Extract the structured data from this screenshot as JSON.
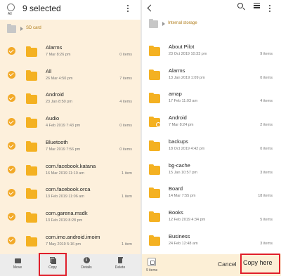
{
  "left": {
    "all_label": "All",
    "title": "9 selected",
    "breadcrumb": "SD card",
    "items": [
      {
        "name": "Alarms",
        "date": "7 Mar 8:26 pm",
        "count": "0 items"
      },
      {
        "name": "All",
        "date": "26 Mar 4:50 pm",
        "count": "7 items"
      },
      {
        "name": "Android",
        "date": "23 Jan 8:50 pm",
        "count": "4 items"
      },
      {
        "name": "Audio",
        "date": "4 Feb 2019 7:43 pm",
        "count": "0 items"
      },
      {
        "name": "Bluetooth",
        "date": "7 Mar 2019 7:56 pm",
        "count": "0 items"
      },
      {
        "name": "com.facebook.katana",
        "date": "16 Mar 2019 11:10 am",
        "count": "1 item"
      },
      {
        "name": "com.facebook.orca",
        "date": "13 Feb 2019 11:06 am",
        "count": "1 item"
      },
      {
        "name": "com.garena.msdk",
        "date": "13 Feb 2019 8:28 pm",
        "count": ""
      },
      {
        "name": "com.imo.android.imoim",
        "date": "7 May 2019 5:16 pm",
        "count": "1 item"
      }
    ],
    "bottom": {
      "move": "Move",
      "copy": "Copy",
      "details": "Details",
      "delete": "Delete"
    }
  },
  "right": {
    "breadcrumb": "Internal storage",
    "items": [
      {
        "name": "About Pilot",
        "date": "23 Oct 2019 10:33 pm",
        "count": "9 items"
      },
      {
        "name": "Alarms",
        "date": "13 Jan 2019 1:09 pm",
        "count": "0 items"
      },
      {
        "name": "amap",
        "date": "17 Feb 11:03 am",
        "count": "4 items"
      },
      {
        "name": "Android",
        "date": "7 Mar 8:24 pm",
        "count": "2 items"
      },
      {
        "name": "backups",
        "date": "18 Oct 2019 4:42 pm",
        "count": "0 items"
      },
      {
        "name": "bg-cache",
        "date": "15 Jan 10:57 pm",
        "count": "3 items"
      },
      {
        "name": "Board",
        "date": "14 Mar 7:55 pm",
        "count": "18 items"
      },
      {
        "name": "Books",
        "date": "12 Feb 2019 4:34 pm",
        "count": "5 items"
      },
      {
        "name": "Business",
        "date": "24 Feb 12:48 am",
        "count": "3 items"
      }
    ],
    "bottom": {
      "items_label": "9 items",
      "cancel": "Cancel",
      "copy_here": "Copy here"
    }
  },
  "colors": {
    "accent": "#f2a928",
    "folder": "#f4b122",
    "highlight_box": "#e01e2a",
    "left_bg": "#fdf0dc"
  }
}
